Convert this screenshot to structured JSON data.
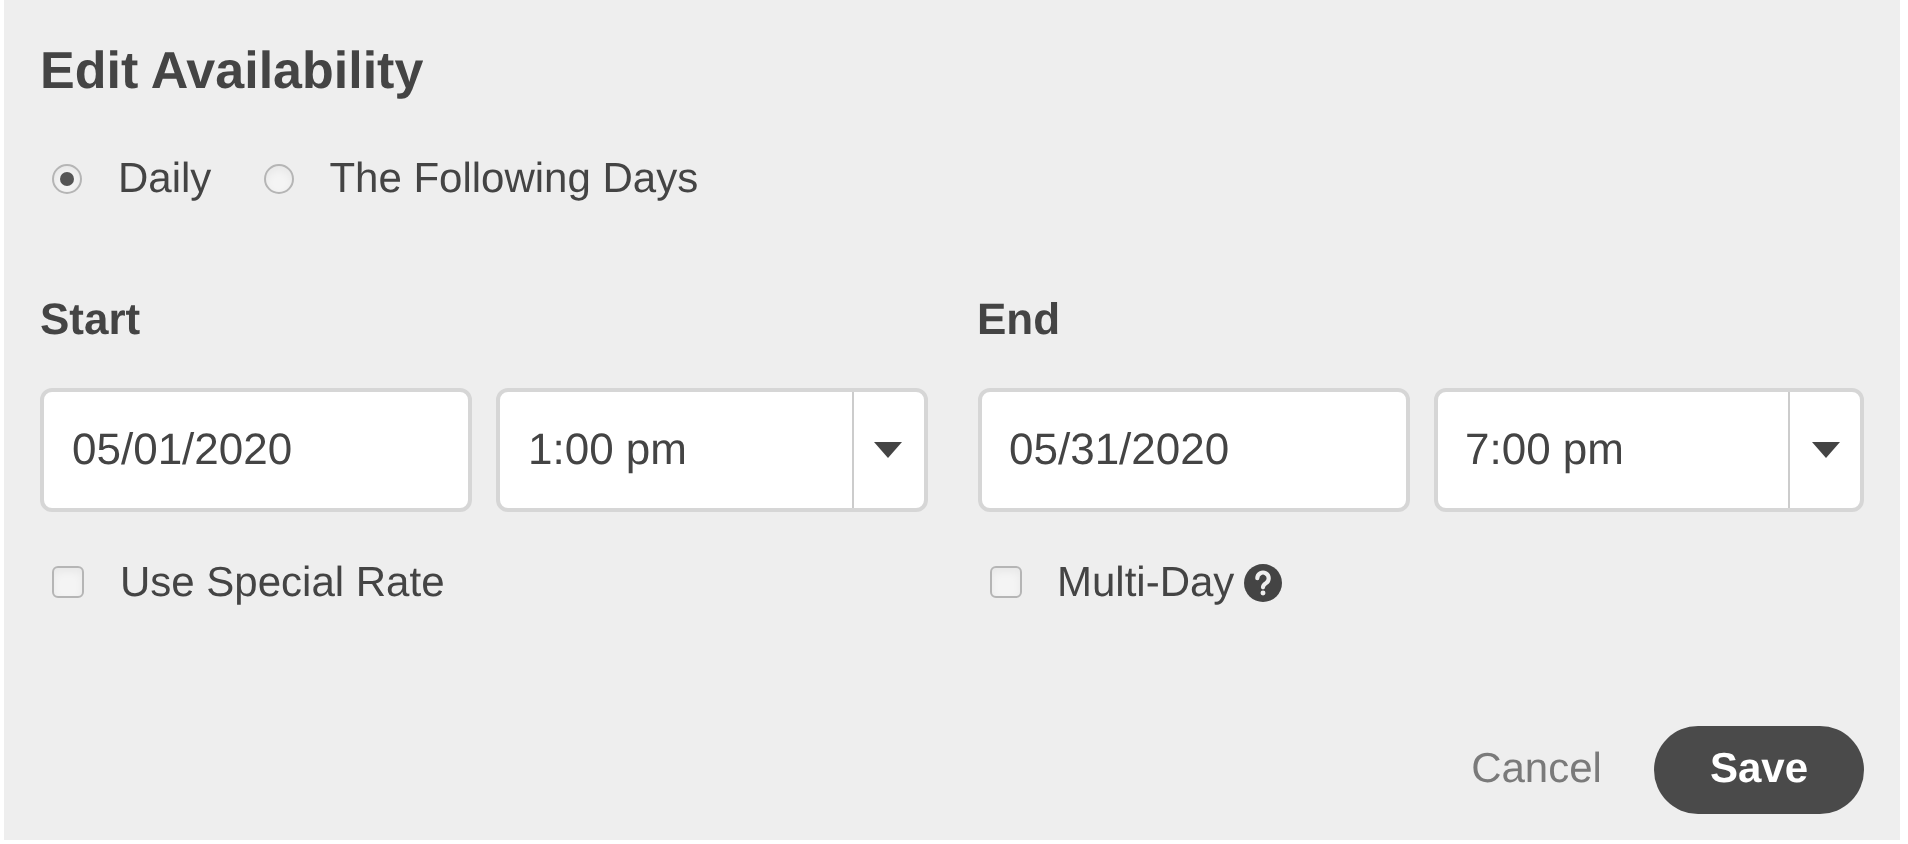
{
  "title": "Edit Availability",
  "frequency": [
    {
      "label": "Daily",
      "selected": true
    },
    {
      "label": "The Following Days",
      "selected": false
    }
  ],
  "sections": [
    {
      "label": "Start",
      "date": "05/01/2020",
      "time": "1:00 pm",
      "option": {
        "label": "Use Special Rate",
        "checked": false,
        "kind": "plain"
      }
    },
    {
      "label": "End",
      "date": "05/31/2020",
      "time": "7:00 pm",
      "option": {
        "label": "Multi-Day",
        "checked": false,
        "kind": "help"
      }
    }
  ],
  "buttons": [
    {
      "label": "Cancel",
      "kind": "link"
    },
    {
      "label": "Save",
      "kind": "primary"
    }
  ]
}
